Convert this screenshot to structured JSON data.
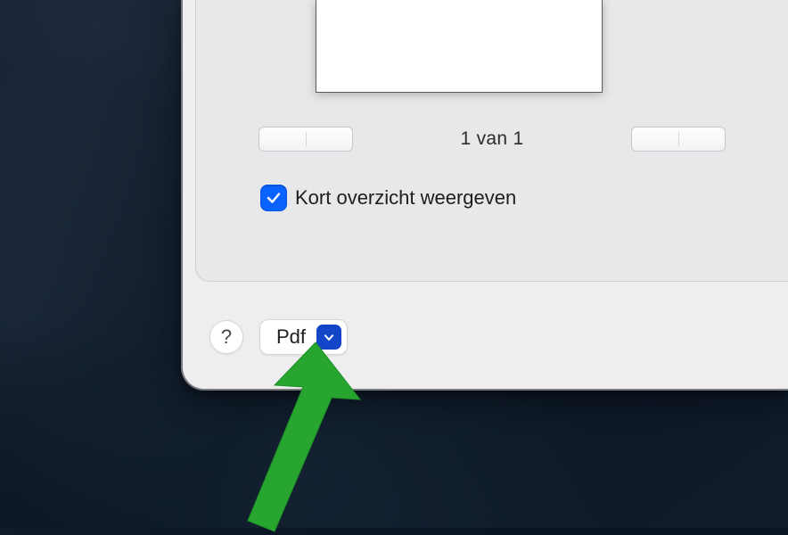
{
  "pager": {
    "page_indicator": "1 van 1"
  },
  "summary": {
    "label": "Kort overzicht weergeven",
    "checked": true
  },
  "footer": {
    "help_label": "?",
    "pdf_label": "Pdf"
  }
}
